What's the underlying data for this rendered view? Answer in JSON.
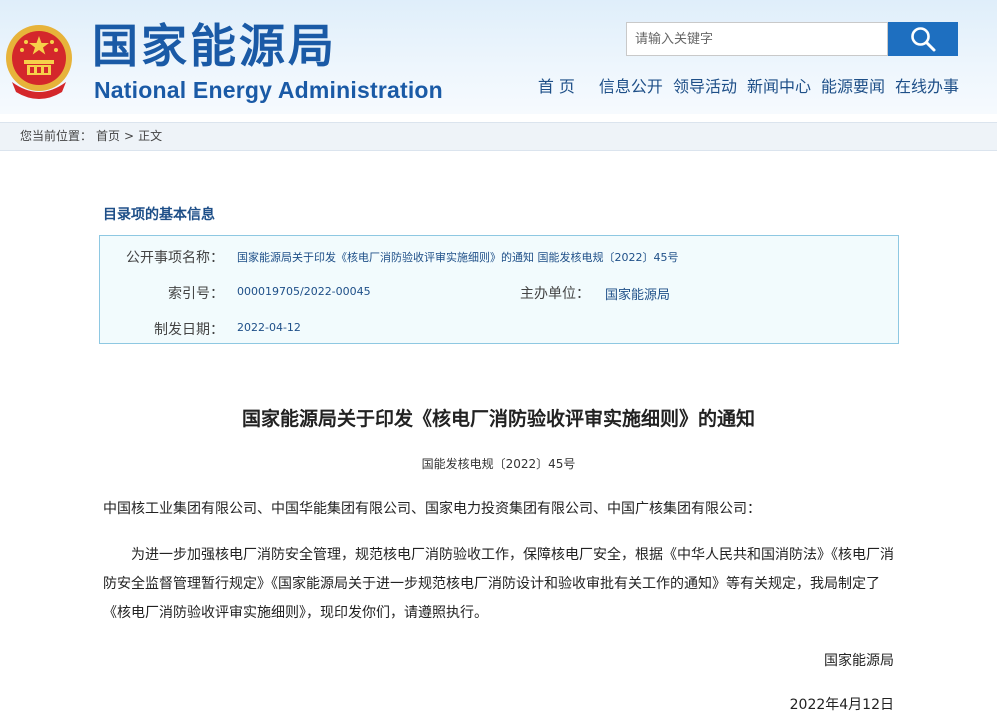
{
  "header": {
    "logo_cn": "国家能源局",
    "logo_en": "National Energy Administration",
    "search_placeholder": "请输入关键字",
    "nav": [
      "首 页",
      "信息公开",
      "领导活动",
      "新闻中心",
      "能源要闻",
      "在线办事"
    ]
  },
  "breadcrumb": {
    "prefix": "您当前位置：",
    "home": "首页",
    "sep": ">",
    "current": "正文"
  },
  "info": {
    "section_title": "目录项的基本信息",
    "name_label": "公开事项名称：",
    "name_value": "国家能源局关于印发《核电厂消防验收评审实施细则》的通知 国能发核电规〔2022〕45号",
    "index_label": "索引号：",
    "index_value": "000019705/2022-00045",
    "org_label": "主办单位：",
    "org_value": "国家能源局",
    "date_label": "制发日期：",
    "date_value": "2022-04-12"
  },
  "article": {
    "title": "国家能源局关于印发《核电厂消防验收评审实施细则》的通知",
    "doc_number": "国能发核电规〔2022〕45号",
    "recipients": "中国核工业集团有限公司、中国华能集团有限公司、国家电力投资集团有限公司、中国广核集团有限公司：",
    "body": "为进一步加强核电厂消防安全管理，规范核电厂消防验收工作，保障核电厂安全，根据《中华人民共和国消防法》《核电厂消防安全监督管理暂行规定》《国家能源局关于进一步规范核电厂消防设计和验收审批有关工作的通知》等有关规定，我局制定了《核电厂消防验收评审实施细则》，现印发你们，请遵照执行。",
    "signature": "国家能源局",
    "date": "2022年4月12日"
  },
  "colors": {
    "brand_blue": "#1a5aa6",
    "search_button": "#1e6fc0",
    "info_border": "#8ec8e2"
  }
}
